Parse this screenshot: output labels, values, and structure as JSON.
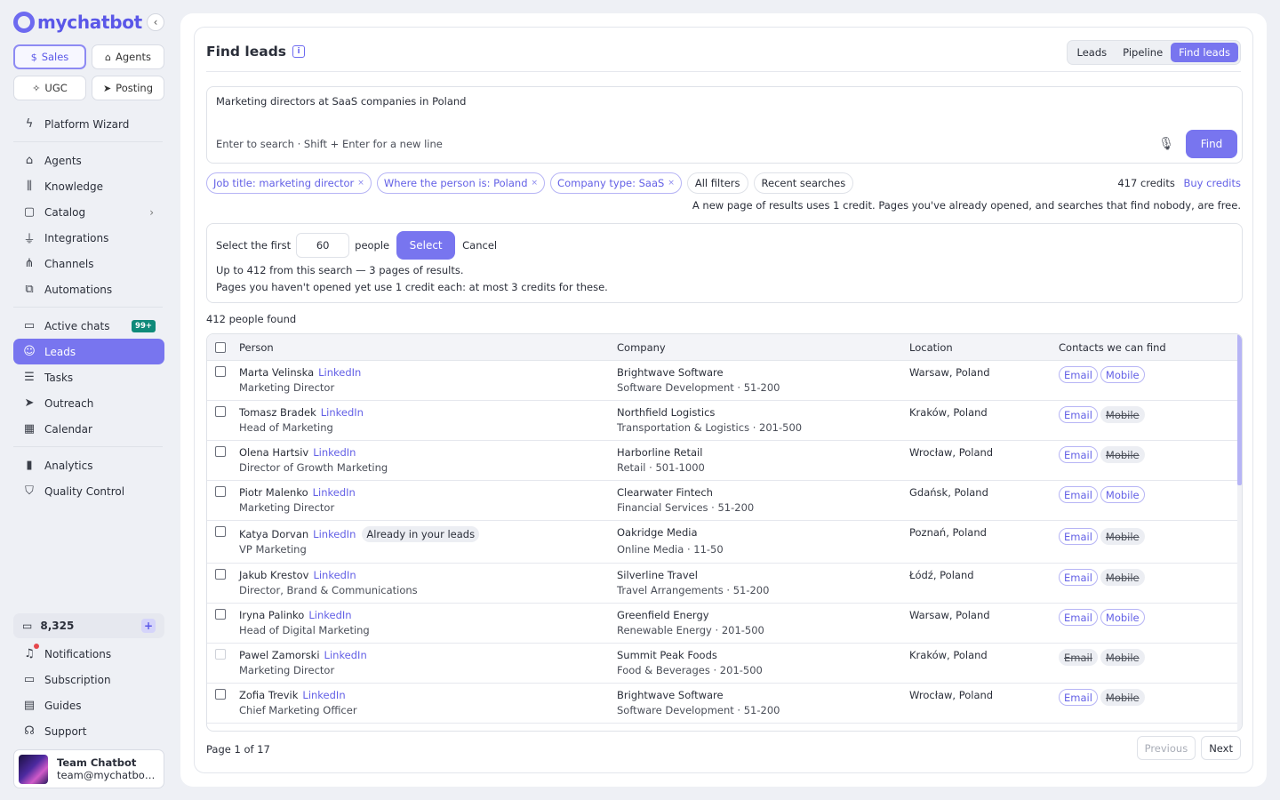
{
  "brand": {
    "name": "mychatbot",
    "accent": "#7875ef"
  },
  "modes": [
    {
      "label": "Sales",
      "icon": "dollar-icon",
      "active": true
    },
    {
      "label": "Agents",
      "icon": "robot-icon",
      "active": false
    },
    {
      "label": "UGC",
      "icon": "sparkle-icon",
      "active": false
    },
    {
      "label": "Posting",
      "icon": "send-icon",
      "active": false
    }
  ],
  "nav": {
    "wizard": "Platform Wizard",
    "agents": "Agents",
    "knowledge": "Knowledge",
    "catalog": "Catalog",
    "integrations": "Integrations",
    "channels": "Channels",
    "automations": "Automations",
    "active_chats": "Active chats",
    "active_chats_badge": "99+",
    "leads": "Leads",
    "tasks": "Tasks",
    "outreach": "Outreach",
    "calendar": "Calendar",
    "analytics": "Analytics",
    "quality": "Quality Control"
  },
  "account": {
    "credits": "8,325",
    "notifications": "Notifications",
    "subscription": "Subscription",
    "guides": "Guides",
    "support": "Support",
    "user_name": "Team Chatbot",
    "user_email": "team@mychatbot.com"
  },
  "header": {
    "title": "Find leads",
    "tabs": [
      {
        "label": "Leads",
        "active": false
      },
      {
        "label": "Pipeline",
        "active": false
      },
      {
        "label": "Find leads",
        "active": true
      }
    ]
  },
  "search": {
    "query": "Marketing directors at SaaS companies in Poland",
    "hint": "Enter to search · Shift + Enter for a new line",
    "find_label": "Find"
  },
  "filters": {
    "chips": [
      "Job title: marketing director",
      "Where the person is: Poland",
      "Company type: SaaS"
    ],
    "remove_symbol": "×",
    "all_filters": "All filters",
    "recent": "Recent searches",
    "credits_text": "417 credits",
    "buy_credits": "Buy credits",
    "credit_note": "A new page of results uses 1 credit. Pages you've already opened, and searches that find nobody, are free."
  },
  "selection": {
    "prefix": "Select the first",
    "count": "60",
    "suffix": "people",
    "select_label": "Select",
    "cancel_label": "Cancel",
    "line1": "Up to 412 from this search — 3 pages of results.",
    "line2": "Pages you haven't opened yet use 1 credit each: at most 3 credits for these."
  },
  "results": {
    "found_text": "412 people found",
    "columns": {
      "person": "Person",
      "company": "Company",
      "location": "Location",
      "contacts": "Contacts we can find"
    },
    "linkedin_label": "LinkedIn",
    "already_label": "Already in your leads",
    "email_label": "Email",
    "mobile_label": "Mobile",
    "rows": [
      {
        "name": "Marta Velinska",
        "title": "Marketing Director",
        "company": "Brightwave Software",
        "industry": "Software Development · 51-200",
        "location": "Warsaw, Poland",
        "email": true,
        "mobile": true,
        "already": false,
        "disabled": false
      },
      {
        "name": "Tomasz Bradek",
        "title": "Head of Marketing",
        "company": "Northfield Logistics",
        "industry": "Transportation & Logistics · 201-500",
        "location": "Kraków, Poland",
        "email": true,
        "mobile": false,
        "already": false,
        "disabled": false
      },
      {
        "name": "Olena Hartsiv",
        "title": "Director of Growth Marketing",
        "company": "Harborline Retail",
        "industry": "Retail · 501-1000",
        "location": "Wrocław, Poland",
        "email": true,
        "mobile": false,
        "already": false,
        "disabled": false
      },
      {
        "name": "Piotr Malenko",
        "title": "Marketing Director",
        "company": "Clearwater Fintech",
        "industry": "Financial Services · 51-200",
        "location": "Gdańsk, Poland",
        "email": true,
        "mobile": true,
        "already": false,
        "disabled": false
      },
      {
        "name": "Katya Dorvan",
        "title": "VP Marketing",
        "company": "Oakridge Media",
        "industry": "Online Media · 11-50",
        "location": "Poznań, Poland",
        "email": true,
        "mobile": false,
        "already": true,
        "disabled": false
      },
      {
        "name": "Jakub Krestov",
        "title": "Director, Brand & Communications",
        "company": "Silverline Travel",
        "industry": "Travel Arrangements · 51-200",
        "location": "Łódź, Poland",
        "email": true,
        "mobile": false,
        "already": false,
        "disabled": false
      },
      {
        "name": "Iryna Palinko",
        "title": "Head of Digital Marketing",
        "company": "Greenfield Energy",
        "industry": "Renewable Energy · 201-500",
        "location": "Warsaw, Poland",
        "email": true,
        "mobile": true,
        "already": false,
        "disabled": false
      },
      {
        "name": "Pawel Zamorski",
        "title": "Marketing Director",
        "company": "Summit Peak Foods",
        "industry": "Food & Beverages · 201-500",
        "location": "Kraków, Poland",
        "email": false,
        "mobile": false,
        "already": false,
        "disabled": true
      },
      {
        "name": "Zofia Trevik",
        "title": "Chief Marketing Officer",
        "company": "Brightwave Software",
        "industry": "Software Development · 51-200",
        "location": "Wrocław, Poland",
        "email": true,
        "mobile": false,
        "already": false,
        "disabled": false
      }
    ]
  },
  "pagination": {
    "text": "Page 1 of 17",
    "previous": "Previous",
    "next": "Next"
  }
}
